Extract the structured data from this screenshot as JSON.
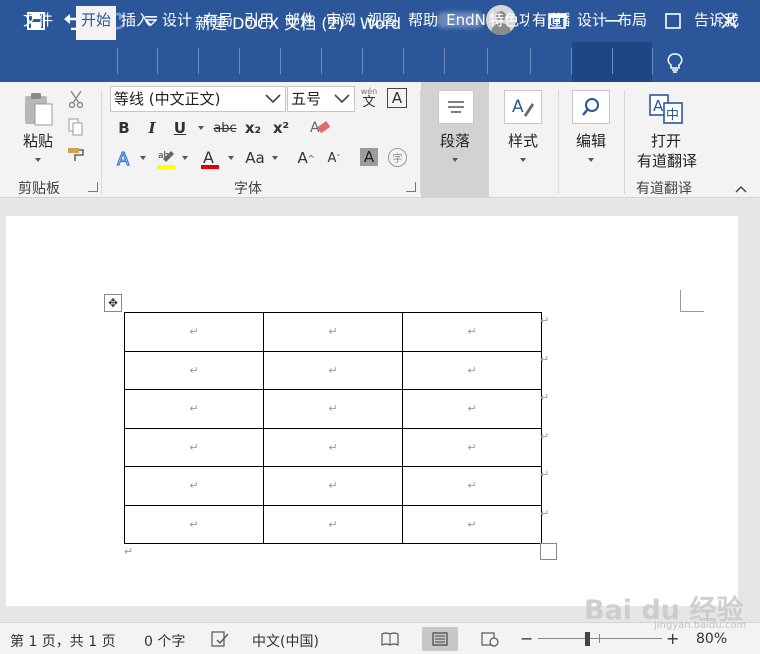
{
  "window": {
    "title": "新建 DOCX 文档 (2)  -  Word",
    "colors": {
      "brand": "#2b579a",
      "ribbon_bg": "#f3f3f3",
      "doc_bg": "#e6e6e6"
    }
  },
  "titlebar": {
    "icons": [
      "save-icon",
      "undo-icon",
      "redo-icon",
      "customize-qat-icon",
      "ribbon-display-options-icon",
      "minimize-icon",
      "maximize-icon",
      "close-icon"
    ]
  },
  "tabs": [
    {
      "label": "文件"
    },
    {
      "label": "开始",
      "active": true
    },
    {
      "label": "插入"
    },
    {
      "label": "设计"
    },
    {
      "label": "布局"
    },
    {
      "label": "引用"
    },
    {
      "label": "邮件"
    },
    {
      "label": "审阅"
    },
    {
      "label": "视图"
    },
    {
      "label": "帮助"
    },
    {
      "label": "EndN"
    },
    {
      "label": "特色功"
    },
    {
      "label": "有道翻"
    },
    {
      "label": "设计",
      "contextual": true
    },
    {
      "label": "布局",
      "contextual": true
    },
    {
      "label": "告诉我"
    }
  ],
  "ribbon": {
    "clipboard": {
      "paste_label": "粘贴",
      "group_label": "剪贴板"
    },
    "font": {
      "font_name": "等线 (中文正文)",
      "font_size": "五号",
      "phonetic": "wén",
      "bold": "B",
      "italic": "I",
      "underline": "U",
      "strike": "abc",
      "subscript": "x₂",
      "superscript": "x²",
      "grow": "A",
      "shrink": "A",
      "change_case": "Aa",
      "char_shading": "A",
      "enclose": "字",
      "group_label": "字体"
    },
    "paragraph": {
      "label": "段落"
    },
    "styles": {
      "label": "样式"
    },
    "editing": {
      "label": "编辑"
    },
    "youdao": {
      "line1": "打开",
      "line2": "有道翻译",
      "group_label": "有道翻译"
    }
  },
  "document": {
    "table": {
      "rows": 6,
      "cols": 3,
      "cell_mark": "↵"
    },
    "para_mark": "↵"
  },
  "statusbar": {
    "page": "第 1 页，共 1 页",
    "words": "0 个字",
    "language": "中文(中国)",
    "zoom_minus": "−",
    "zoom_plus": "+",
    "zoom": "80%"
  },
  "watermark": {
    "text": "Bai du 经验",
    "sub": "jingyan.baidu.com"
  }
}
